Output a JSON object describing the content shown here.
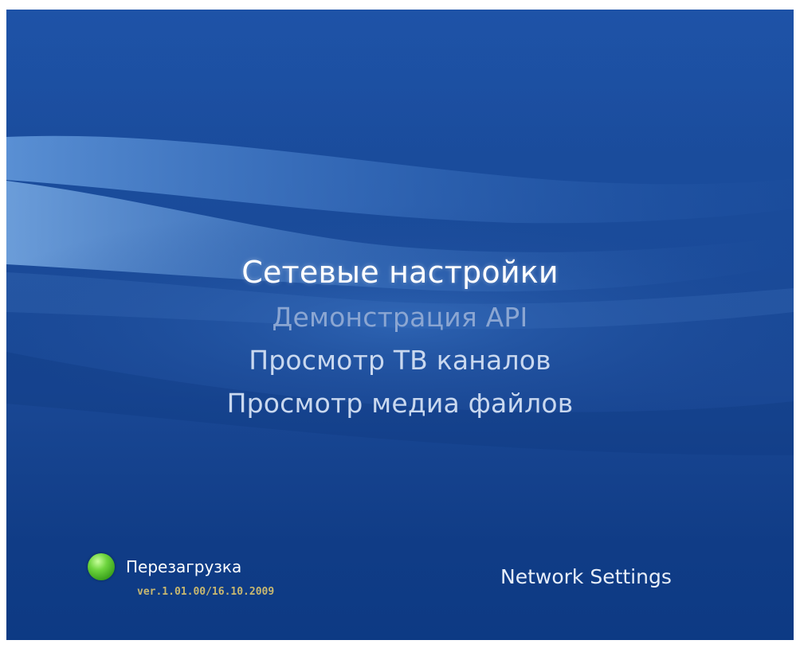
{
  "menu": {
    "items": [
      {
        "label": "Сетевые настройки",
        "state": "selected"
      },
      {
        "label": "Демонстрация API",
        "state": "disabled"
      },
      {
        "label": "Просмотр ТВ каналов",
        "state": "normal"
      },
      {
        "label": "Просмотр медиа файлов",
        "state": "normal"
      }
    ]
  },
  "footer": {
    "reboot_label": "Перезагрузка",
    "reboot_icon": "green-circle-icon",
    "version": "ver.1.01.00/16.10.2009",
    "screen_name": "Network Settings"
  },
  "colors": {
    "background": "#1a4895",
    "selected_text": "#ffffff",
    "normal_text": "#c9d8ef",
    "disabled_text": "#8ba6d2",
    "version_text": "#c8b870",
    "reboot_indicator": "#5cc832"
  }
}
